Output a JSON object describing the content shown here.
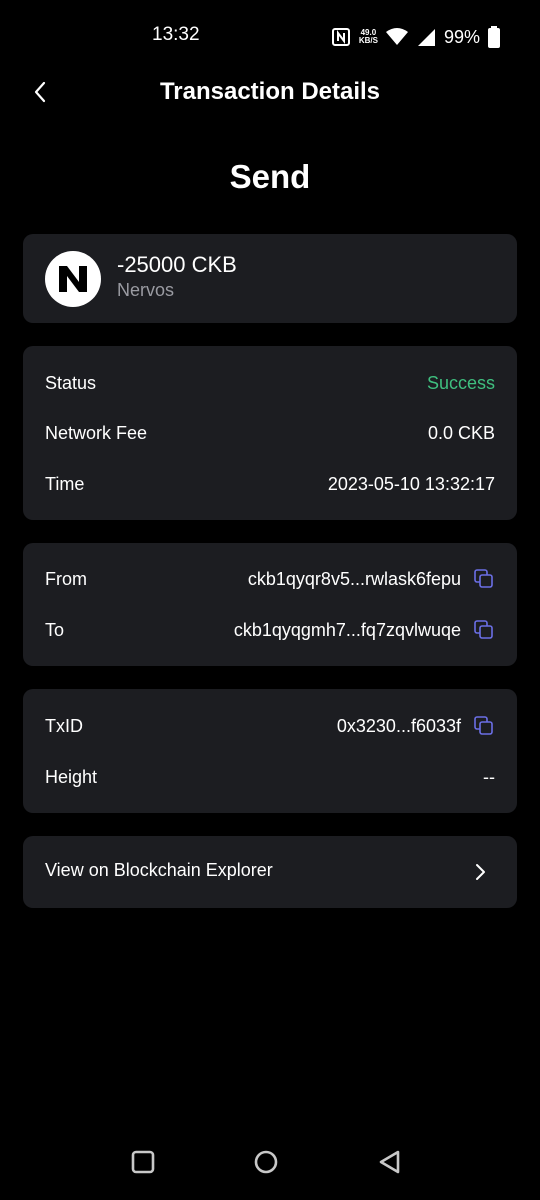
{
  "status_bar": {
    "time": "13:32",
    "net_speed": "49.0",
    "net_unit": "KB/S",
    "battery": "99%"
  },
  "header": {
    "title": "Transaction Details"
  },
  "transaction": {
    "type": "Send",
    "amount": "-25000 CKB",
    "asset_name": "Nervos",
    "status_label": "Status",
    "status_value": "Success",
    "fee_label": "Network Fee",
    "fee_value": "0.0 CKB",
    "time_label": "Time",
    "time_value": "2023-05-10 13:32:17",
    "from_label": "From",
    "from_value": "ckb1qyqr8v5...rwlask6fepu",
    "to_label": "To",
    "to_value": "ckb1qyqgmh7...fq7zqvlwuqe",
    "txid_label": "TxID",
    "txid_value": "0x3230...f6033f",
    "height_label": "Height",
    "height_value": "--"
  },
  "explorer": {
    "label": "View on Blockchain Explorer"
  },
  "colors": {
    "background": "#000000",
    "card": "#1c1d21",
    "success": "#3fbf7f",
    "accent_icon": "#6b6fe6",
    "secondary_text": "#9a9ba2"
  }
}
